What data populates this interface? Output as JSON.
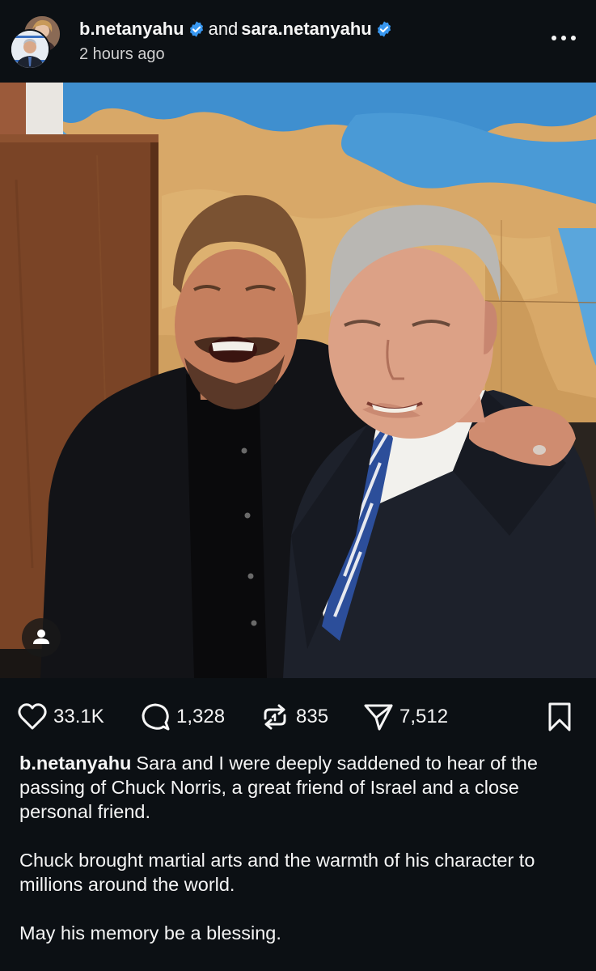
{
  "header": {
    "author_primary": "b.netanyahu",
    "conjunction": "and",
    "author_secondary": "sara.netanyahu",
    "timestamp": "2 hours ago",
    "more_icon": "more-horizontal-icon",
    "verified_icon": "verified-badge-icon",
    "verified_color": "#3897f0"
  },
  "photo": {
    "tag_icon": "user-tag-icon"
  },
  "actions": {
    "likes": "33.1K",
    "comments": "1,328",
    "reposts": "835",
    "shares": "7,512",
    "icons": [
      "heart-icon",
      "comment-icon",
      "repost-icon",
      "share-icon",
      "bookmark-icon"
    ]
  },
  "caption": {
    "username": "b.netanyahu",
    "line1": "Sara and I were deeply saddened to hear of the passing of Chuck Norris, a great friend of Israel and a close personal friend.",
    "paragraph2": "Chuck brought martial arts and the warmth of his character to millions around the world.",
    "paragraph3": "May his memory be a blessing."
  },
  "colors": {
    "background": "#0c1014",
    "text": "#f5f5f5",
    "secondary_text": "#d0d0d0"
  }
}
